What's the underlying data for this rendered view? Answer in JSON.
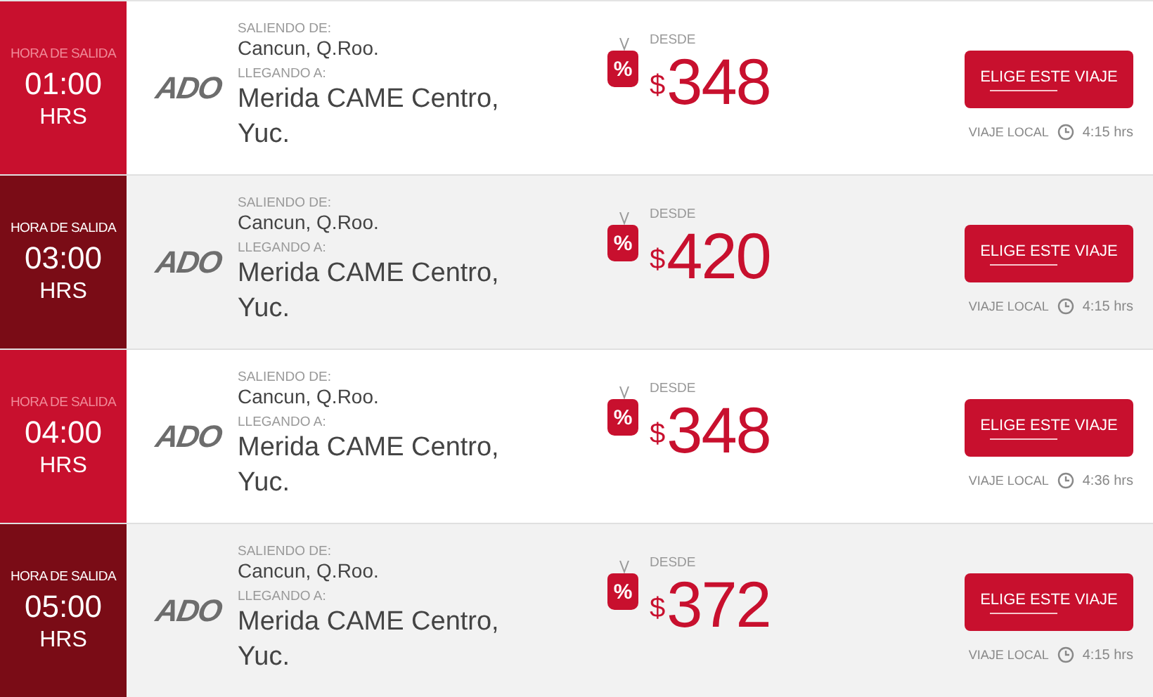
{
  "trips": [
    {
      "alternate": false,
      "time_label": "HORA DE SALIDA",
      "time": "01:00",
      "time_unit": "HRS",
      "operator": "ADO",
      "from_label": "SALIENDO DE:",
      "from": "Cancun, Q.Roo.",
      "to_label": "LLEGANDO A:",
      "to": "Merida CAME Centro, Yuc.",
      "discount_mark": "%",
      "price_label": "DESDE",
      "currency": "$",
      "price": "348",
      "button": "ELIGE ESTE VIAJE",
      "trip_type": "VIAJE LOCAL",
      "duration": "4:15 hrs"
    },
    {
      "alternate": true,
      "time_label": "HORA DE SALIDA",
      "time": "03:00",
      "time_unit": "HRS",
      "operator": "ADO",
      "from_label": "SALIENDO DE:",
      "from": "Cancun, Q.Roo.",
      "to_label": "LLEGANDO A:",
      "to": "Merida CAME Centro, Yuc.",
      "discount_mark": "%",
      "price_label": "DESDE",
      "currency": "$",
      "price": "420",
      "button": "ELIGE ESTE VIAJE",
      "trip_type": "VIAJE LOCAL",
      "duration": "4:15 hrs"
    },
    {
      "alternate": false,
      "time_label": "HORA DE SALIDA",
      "time": "04:00",
      "time_unit": "HRS",
      "operator": "ADO",
      "from_label": "SALIENDO DE:",
      "from": "Cancun, Q.Roo.",
      "to_label": "LLEGANDO A:",
      "to": "Merida CAME Centro, Yuc.",
      "discount_mark": "%",
      "price_label": "DESDE",
      "currency": "$",
      "price": "348",
      "button": "ELIGE ESTE VIAJE",
      "trip_type": "VIAJE LOCAL",
      "duration": "4:36 hrs"
    },
    {
      "alternate": true,
      "time_label": "HORA DE SALIDA",
      "time": "05:00",
      "time_unit": "HRS",
      "operator": "ADO",
      "from_label": "SALIENDO DE:",
      "from": "Cancun, Q.Roo.",
      "to_label": "LLEGANDO A:",
      "to": "Merida CAME Centro, Yuc.",
      "discount_mark": "%",
      "price_label": "DESDE",
      "currency": "$",
      "price": "372",
      "button": "ELIGE ESTE VIAJE",
      "trip_type": "VIAJE LOCAL",
      "duration": "4:15 hrs"
    }
  ]
}
